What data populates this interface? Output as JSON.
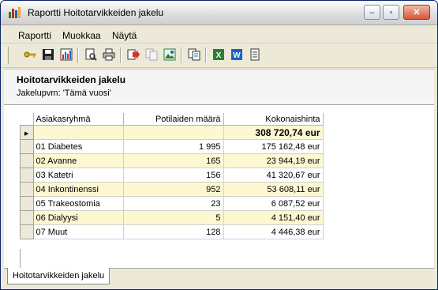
{
  "window": {
    "title": "Raportti Hoitotarvikkeiden jakelu",
    "controls": {
      "minimize": "–",
      "maximize": "▫",
      "close": "✕"
    }
  },
  "menu": [
    "Raportti",
    "Muokkaa",
    "Näytä"
  ],
  "toolbar": [
    "key-icon",
    "save-icon",
    "report-icon",
    "print-preview-icon",
    "print-icon",
    "export-icon",
    "copy-disabled-icon",
    "image-icon",
    "copy-icon",
    "excel-icon",
    "word-icon",
    "notepad-icon"
  ],
  "report": {
    "title": "Hoitotarvikkeiden jakelu",
    "subtitle": "Jakelupvm: 'Tämä vuosi'"
  },
  "table": {
    "columns": [
      "Asiakasryhmä",
      "Potilaiden määrä",
      "Kokonaishinta"
    ],
    "total": "308 720,74 eur",
    "rows": [
      [
        "01 Diabetes",
        "1 995",
        "175 162,48 eur"
      ],
      [
        "02 Avanne",
        "165",
        "23 944,19 eur"
      ],
      [
        "03 Katetri",
        "156",
        "41 320,67 eur"
      ],
      [
        "04 Inkontinenssi",
        "952",
        "53 608,11 eur"
      ],
      [
        "05 Trakeostomia",
        "23",
        "6 087,52 eur"
      ],
      [
        "06 Dialyysi",
        "5",
        "4 151,40 eur"
      ],
      [
        "07 Muut",
        "128",
        "4 446,38 eur"
      ]
    ]
  },
  "tabs": [
    "Hoitotarvikkeiden jakelu"
  ],
  "colors": {
    "alt_row": "#fdf7d2",
    "chrome": "#ece9d8",
    "title_border": "#0a246a"
  }
}
